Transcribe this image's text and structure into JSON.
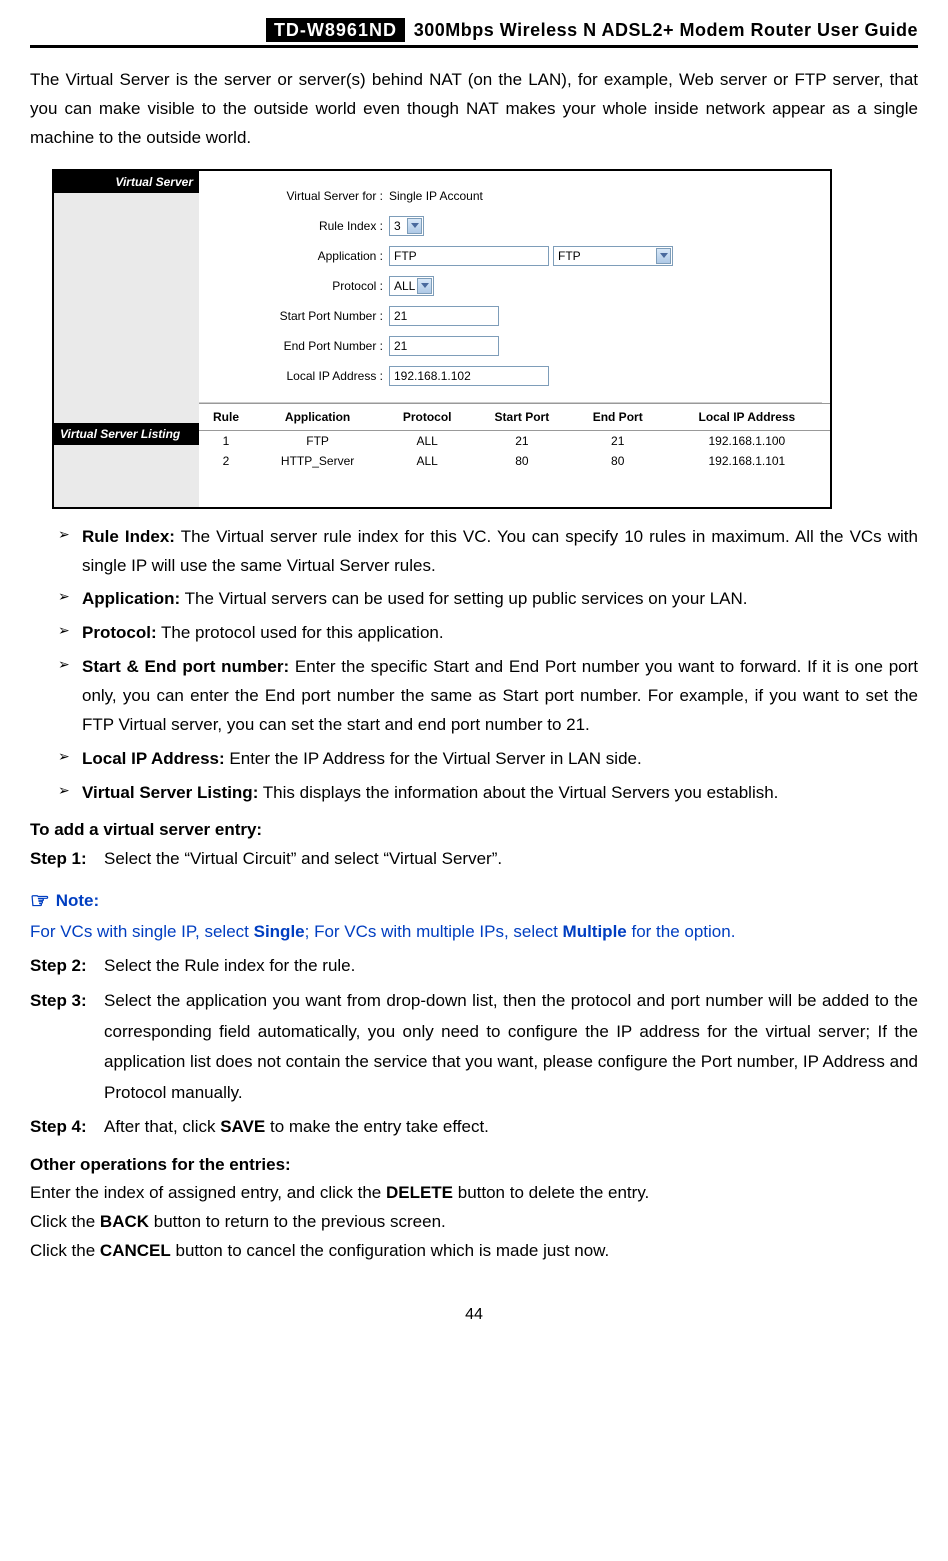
{
  "header": {
    "model": "TD-W8961ND",
    "title": "300Mbps Wireless N ADSL2+ Modem Router User Guide"
  },
  "intro": "The Virtual Server is the server or server(s) behind NAT (on the LAN), for example, Web server or FTP server, that you can make visible to the outside world even though NAT makes your whole inside network appear as a single machine to the outside world.",
  "ss": {
    "sidebar1": "Virtual Server",
    "sidebar2": "Virtual Server Listing",
    "labels": {
      "vs_for": "Virtual Server for :",
      "rule_index": "Rule Index :",
      "application": "Application :",
      "protocol": "Protocol :",
      "start_port": "Start Port Number :",
      "end_port": "End Port Number :",
      "local_ip": "Local IP Address :"
    },
    "values": {
      "vs_for": "Single IP Account",
      "rule_index": "3",
      "application_input": "FTP",
      "application_select": "FTP",
      "protocol": "ALL",
      "start_port": "21",
      "end_port": "21",
      "local_ip": "192.168.1.102"
    },
    "table_headers": [
      "Rule",
      "Application",
      "Protocol",
      "Start Port",
      "End Port",
      "Local IP Address"
    ],
    "table_rows": [
      [
        "1",
        "FTP",
        "ALL",
        "21",
        "21",
        "192.168.1.100"
      ],
      [
        "2",
        "HTTP_Server",
        "ALL",
        "80",
        "80",
        "192.168.1.101"
      ]
    ]
  },
  "bullets": [
    {
      "term": "Rule Index:",
      "desc": " The Virtual server rule index for this VC. You can specify 10 rules in maximum. All the VCs with single IP will use the same Virtual Server rules."
    },
    {
      "term": "Application:",
      "desc": " The Virtual servers can be used for setting up public services on your LAN."
    },
    {
      "term": "Protocol:",
      "desc": " The protocol used for this application."
    },
    {
      "term": "Start & End port number:",
      "desc": " Enter the specific Start and End Port number you want to forward. If it is one port only, you can enter the End port number the same as Start port number. For example, if you want to set the FTP Virtual server, you can set the start and end port number to 21."
    },
    {
      "term": "Local IP Address:",
      "desc": " Enter the IP Address for the Virtual Server in LAN side."
    },
    {
      "term": "Virtual Server Listing:",
      "desc": " This displays the information about the Virtual Servers you establish."
    }
  ],
  "add_heading": "To add a virtual server entry:",
  "steps_pre": [
    {
      "label": "Step 1:",
      "body": "Select the “Virtual Circuit” and select “Virtual Server”."
    }
  ],
  "note": {
    "heading": "Note:",
    "body_parts": [
      "For VCs with single IP, select ",
      "Single",
      "; For VCs with multiple IPs, select ",
      "Multiple",
      " for the option."
    ]
  },
  "steps_post": [
    {
      "label": "Step 2:",
      "body": "Select the Rule index for the rule."
    },
    {
      "label": "Step 3:",
      "body": "Select the application you want from drop-down list, then the protocol and port number will be added to the corresponding field automatically, you only need to configure the IP address for the virtual server; If the application list does not contain the service that you want, please configure the Port number, IP Address and Protocol manually."
    },
    {
      "label": "Step 4:",
      "body_parts": [
        "After that, click ",
        "SAVE",
        " to make the entry take effect."
      ]
    }
  ],
  "other_heading": "Other operations for the entries:",
  "other_lines": [
    {
      "parts": [
        "Enter the index of assigned entry, and click the ",
        "DELETE",
        " button to delete the entry."
      ]
    },
    {
      "parts": [
        "Click the ",
        "BACK",
        " button to return to the previous screen."
      ]
    },
    {
      "parts": [
        "Click the ",
        "CANCEL",
        " button to cancel the configuration which is made just now."
      ]
    }
  ],
  "page_number": "44"
}
